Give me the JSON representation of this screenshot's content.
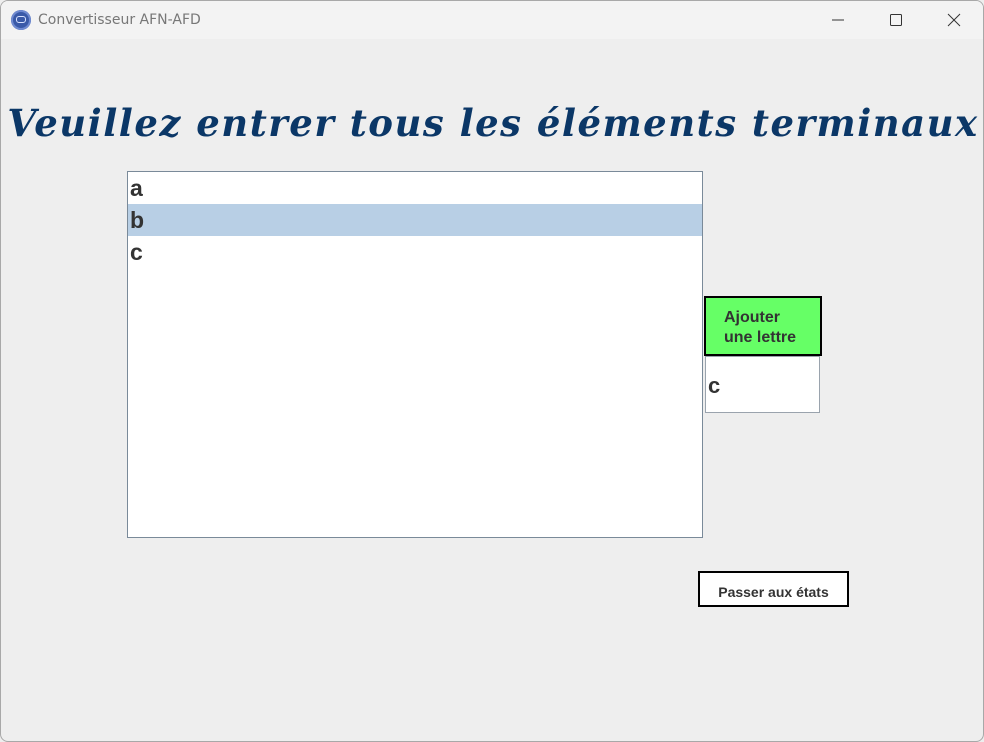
{
  "window": {
    "title": "Convertisseur AFN-AFD",
    "icon": "app-logo-icon",
    "controls": [
      "minimize-icon",
      "maximize-icon",
      "close-icon"
    ]
  },
  "main": {
    "heading": "Veuillez entrer tous les éléments terminaux",
    "terminals": [
      {
        "label": "a",
        "selected": false
      },
      {
        "label": "b",
        "selected": true
      },
      {
        "label": "c",
        "selected": false
      }
    ],
    "add_button_line1": "Ajouter",
    "add_button_line2": "une lettre",
    "letter_input_value": "c",
    "next_button_label": "Passer aux états"
  },
  "colors": {
    "heading": "#0b3767",
    "add_button_bg": "#66ff66",
    "selected_row": "#b8cfe5",
    "window_bg": "#eeeeee"
  }
}
